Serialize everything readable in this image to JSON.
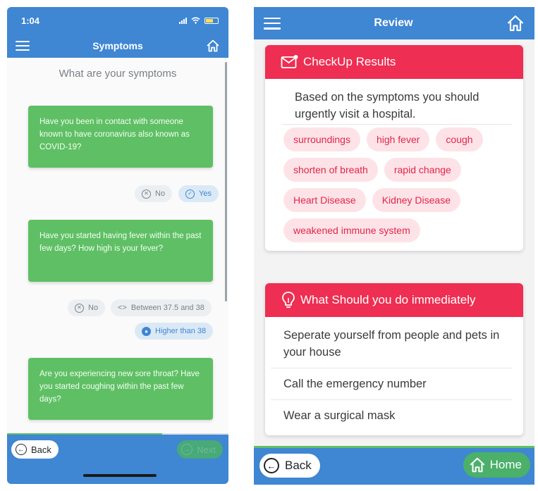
{
  "left_phone": {
    "status_bar": {
      "time": "1:04"
    },
    "app_bar": {
      "title": "Symptoms"
    },
    "prompt": "What are your symptoms",
    "questions": [
      {
        "text": "Have you been in contact with someone known to have coronavirus also known as COVID-19?"
      },
      {
        "text": "Have you started having fever within the past few days? How high is your fever?"
      },
      {
        "text": "Are you experiencing new sore throat? Have you started coughing within the past few days?"
      }
    ],
    "answers": {
      "q1_no": "No",
      "q1_yes": "Yes",
      "q2_no": "No",
      "q2_between": "Between 37.5 and 38",
      "q2_higher": "Higher than 38"
    },
    "footer": {
      "back_label": "Back",
      "next_label": "Next"
    }
  },
  "right_phone": {
    "app_bar": {
      "title": "Review"
    },
    "results_card": {
      "title": "CheckUp Results",
      "message": "Based on the symptoms you should urgently visit a hospital.",
      "tags": [
        "surroundings",
        "high fever",
        "cough",
        "shorten of breath",
        "rapid change",
        "Heart Disease",
        "Kidney Disease",
        "weakened immune system"
      ]
    },
    "actions_card": {
      "title": "What Should you do immediately",
      "items": [
        "Seperate yourself from people and pets in your house",
        "Call the emergency number",
        "Wear a surgical mask"
      ]
    },
    "footer": {
      "back_label": "Back",
      "home_label": "Home"
    }
  },
  "colors": {
    "primary_blue": "#3f86d3",
    "question_green": "#5fbf65",
    "alert_red": "#ee2e52",
    "tag_pink": "#fde3e7"
  },
  "icons": [
    "menu-icon",
    "home-icon",
    "signal-icon",
    "wifi-icon",
    "battery-icon",
    "close-circle-icon",
    "check-circle-icon",
    "code-icon",
    "radio-selected-icon",
    "arrow-left-icon",
    "arrow-right-icon",
    "mail-alert-icon",
    "lightbulb-icon"
  ]
}
